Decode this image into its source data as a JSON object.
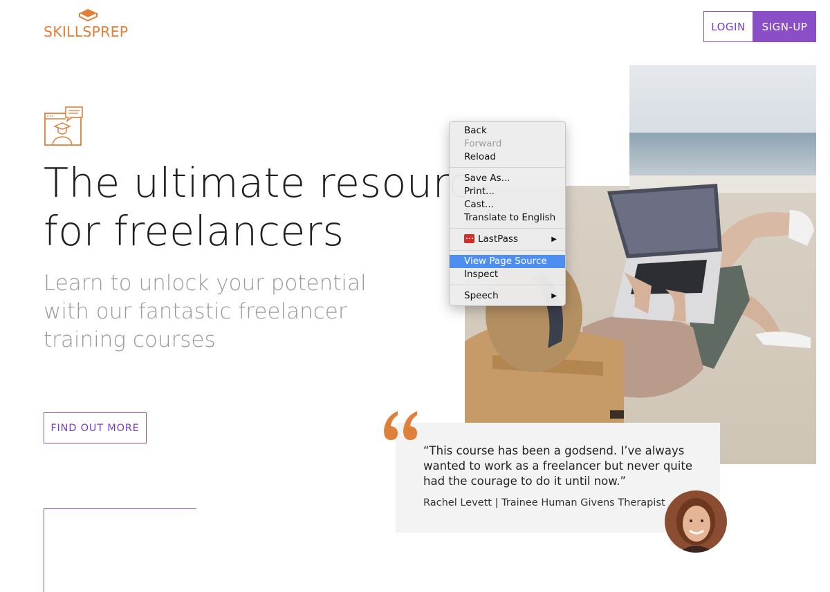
{
  "header": {
    "logo_text": "SKILLSPREP",
    "login_label": "LOGIN",
    "signup_label": "SIGN-UP"
  },
  "hero": {
    "title_line1": "The ultimate resource",
    "title_line2": "for freelancers",
    "subtitle_line1": "Learn to unlock your potential",
    "subtitle_line2": "with our fantastic freelancer",
    "subtitle_line3": "training courses",
    "cta_label": "FIND OUT MORE"
  },
  "testimonial": {
    "quote": "“This course has been a godsend. I’ve always wanted to work as a freelancer but never quite had the courage to do it until now.”",
    "author": "Rachel Levett | Trainee Human Givens Therapist"
  },
  "context_menu": {
    "items": [
      {
        "label": "Back"
      },
      {
        "label": "Forward"
      },
      {
        "label": "Reload"
      },
      {
        "label": "Save As..."
      },
      {
        "label": "Print..."
      },
      {
        "label": "Cast..."
      },
      {
        "label": "Translate to English"
      },
      {
        "label": "LastPass"
      },
      {
        "label": "View Page Source"
      },
      {
        "label": "Inspect"
      },
      {
        "label": "Speech"
      }
    ],
    "submenu_arrow": "▶"
  },
  "colors": {
    "brand_orange": "#e07f3a",
    "brand_purple": "#8a4fc6",
    "menu_highlight": "#4d8ff0"
  },
  "icons": [
    "book-logo-icon",
    "graduate-chat-icon",
    "quote-mark-icon",
    "lastpass-icon",
    "submenu-arrow-icon"
  ]
}
